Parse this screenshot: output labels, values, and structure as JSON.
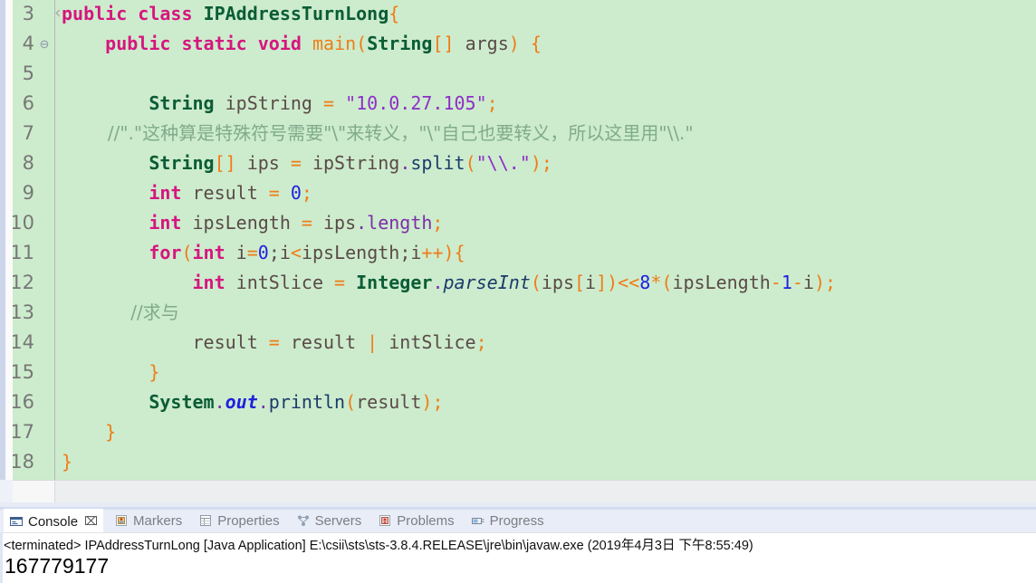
{
  "editor": {
    "first_line": 3,
    "fold_marker_line": 4,
    "fold_marker_glyph": "⊖",
    "collapse_chevron": "‹",
    "background": "#cdeccd",
    "lines": [
      {
        "n": 3,
        "indent": 0,
        "tokens": [
          {
            "t": "public",
            "c": "kw"
          },
          {
            "t": " ",
            "c": "plain"
          },
          {
            "t": "class",
            "c": "kw"
          },
          {
            "t": " ",
            "c": "plain"
          },
          {
            "t": "IPAddressTurnLong",
            "c": "type"
          },
          {
            "t": "{",
            "c": "op"
          }
        ]
      },
      {
        "n": 4,
        "indent": 0,
        "tokens": [
          {
            "t": "    ",
            "c": "plain"
          },
          {
            "t": "public",
            "c": "kw"
          },
          {
            "t": " ",
            "c": "plain"
          },
          {
            "t": "static",
            "c": "kw"
          },
          {
            "t": " ",
            "c": "plain"
          },
          {
            "t": "void",
            "c": "kw"
          },
          {
            "t": " ",
            "c": "plain"
          },
          {
            "t": "main",
            "c": "op"
          },
          {
            "t": "(",
            "c": "op"
          },
          {
            "t": "String",
            "c": "type"
          },
          {
            "t": "[]",
            "c": "op"
          },
          {
            "t": " args",
            "c": "plain"
          },
          {
            "t": ")",
            "c": "op"
          },
          {
            "t": " ",
            "c": "plain"
          },
          {
            "t": "{",
            "c": "op"
          }
        ]
      },
      {
        "n": 5,
        "indent": 0,
        "tokens": []
      },
      {
        "n": 6,
        "indent": 0,
        "tokens": [
          {
            "t": "        ",
            "c": "plain"
          },
          {
            "t": "String",
            "c": "type"
          },
          {
            "t": " ipString ",
            "c": "plain"
          },
          {
            "t": "=",
            "c": "op"
          },
          {
            "t": " ",
            "c": "plain"
          },
          {
            "t": "\"10.0.27.105\"",
            "c": "str"
          },
          {
            "t": ";",
            "c": "op"
          }
        ]
      },
      {
        "n": 7,
        "indent": 0,
        "cjk": true,
        "tokens": [
          {
            "t": "        ",
            "c": "plain"
          },
          {
            "t": "//\".\"这种算是特殊符号需要\"\\\"来转义，\"\\\"自己也要转义，所以这里用\"\\\\.\"",
            "c": "cmt"
          }
        ]
      },
      {
        "n": 8,
        "indent": 0,
        "tokens": [
          {
            "t": "        ",
            "c": "plain"
          },
          {
            "t": "String",
            "c": "type"
          },
          {
            "t": "[]",
            "c": "op"
          },
          {
            "t": " ips ",
            "c": "plain"
          },
          {
            "t": "=",
            "c": "op"
          },
          {
            "t": " ipString",
            "c": "plain"
          },
          {
            "t": ".",
            "c": "fld"
          },
          {
            "t": "split",
            "c": "meth"
          },
          {
            "t": "(",
            "c": "op"
          },
          {
            "t": "\"\\\\.\"",
            "c": "str"
          },
          {
            "t": ")",
            "c": "op"
          },
          {
            "t": ";",
            "c": "op"
          }
        ]
      },
      {
        "n": 9,
        "indent": 0,
        "tokens": [
          {
            "t": "        ",
            "c": "plain"
          },
          {
            "t": "int",
            "c": "kw"
          },
          {
            "t": " result ",
            "c": "plain"
          },
          {
            "t": "=",
            "c": "op"
          },
          {
            "t": " ",
            "c": "plain"
          },
          {
            "t": "0",
            "c": "num"
          },
          {
            "t": ";",
            "c": "op"
          }
        ]
      },
      {
        "n": 10,
        "indent": 0,
        "tokens": [
          {
            "t": "        ",
            "c": "plain"
          },
          {
            "t": "int",
            "c": "kw"
          },
          {
            "t": " ipsLength ",
            "c": "plain"
          },
          {
            "t": "=",
            "c": "op"
          },
          {
            "t": " ips",
            "c": "plain"
          },
          {
            "t": ".",
            "c": "fld"
          },
          {
            "t": "length",
            "c": "fld"
          },
          {
            "t": ";",
            "c": "op"
          }
        ]
      },
      {
        "n": 11,
        "indent": 0,
        "tokens": [
          {
            "t": "        ",
            "c": "plain"
          },
          {
            "t": "for",
            "c": "kw"
          },
          {
            "t": "(",
            "c": "op"
          },
          {
            "t": "int",
            "c": "kw"
          },
          {
            "t": " i",
            "c": "plain"
          },
          {
            "t": "=",
            "c": "op"
          },
          {
            "t": "0",
            "c": "num"
          },
          {
            "t": ";i",
            "c": "plain"
          },
          {
            "t": "<",
            "c": "op"
          },
          {
            "t": "ipsLength;i",
            "c": "plain"
          },
          {
            "t": "++",
            "c": "op"
          },
          {
            "t": ")",
            "c": "op"
          },
          {
            "t": "{",
            "c": "op"
          }
        ]
      },
      {
        "n": 12,
        "indent": 0,
        "tokens": [
          {
            "t": "            ",
            "c": "plain"
          },
          {
            "t": "int",
            "c": "kw"
          },
          {
            "t": " intSlice ",
            "c": "plain"
          },
          {
            "t": "=",
            "c": "op"
          },
          {
            "t": " ",
            "c": "plain"
          },
          {
            "t": "Integer",
            "c": "type"
          },
          {
            "t": ".",
            "c": "fld"
          },
          {
            "t": "parseInt",
            "c": "smeth"
          },
          {
            "t": "(",
            "c": "op"
          },
          {
            "t": "ips",
            "c": "plain"
          },
          {
            "t": "[",
            "c": "op"
          },
          {
            "t": "i",
            "c": "plain"
          },
          {
            "t": "]",
            "c": "op"
          },
          {
            "t": ")",
            "c": "op"
          },
          {
            "t": "<<",
            "c": "op"
          },
          {
            "t": "8",
            "c": "num"
          },
          {
            "t": "*",
            "c": "op"
          },
          {
            "t": "(",
            "c": "op"
          },
          {
            "t": "ipsLength",
            "c": "plain"
          },
          {
            "t": "-",
            "c": "op"
          },
          {
            "t": "1",
            "c": "num"
          },
          {
            "t": "-",
            "c": "op"
          },
          {
            "t": "i",
            "c": "plain"
          },
          {
            "t": ")",
            "c": "op"
          },
          {
            "t": ";",
            "c": "op"
          }
        ]
      },
      {
        "n": 13,
        "indent": 0,
        "cjk": true,
        "tokens": [
          {
            "t": "            ",
            "c": "plain"
          },
          {
            "t": "//求与",
            "c": "cmt"
          }
        ]
      },
      {
        "n": 14,
        "indent": 0,
        "tokens": [
          {
            "t": "            result ",
            "c": "plain"
          },
          {
            "t": "=",
            "c": "op"
          },
          {
            "t": " result ",
            "c": "plain"
          },
          {
            "t": "|",
            "c": "op"
          },
          {
            "t": " intSlice",
            "c": "plain"
          },
          {
            "t": ";",
            "c": "op"
          }
        ]
      },
      {
        "n": 15,
        "indent": 0,
        "tokens": [
          {
            "t": "        ",
            "c": "plain"
          },
          {
            "t": "}",
            "c": "op"
          }
        ]
      },
      {
        "n": 16,
        "indent": 0,
        "tokens": [
          {
            "t": "        ",
            "c": "plain"
          },
          {
            "t": "System",
            "c": "type"
          },
          {
            "t": ".",
            "c": "fld"
          },
          {
            "t": "out",
            "c": "sfld"
          },
          {
            "t": ".",
            "c": "fld"
          },
          {
            "t": "println",
            "c": "meth"
          },
          {
            "t": "(",
            "c": "op"
          },
          {
            "t": "result",
            "c": "plain"
          },
          {
            "t": ")",
            "c": "op"
          },
          {
            "t": ";",
            "c": "op"
          }
        ]
      },
      {
        "n": 17,
        "indent": 0,
        "tokens": [
          {
            "t": "    ",
            "c": "plain"
          },
          {
            "t": "}",
            "c": "op"
          }
        ]
      },
      {
        "n": 18,
        "indent": 0,
        "tokens": [
          {
            "t": "}",
            "c": "op"
          }
        ]
      }
    ]
  },
  "console": {
    "tabs": [
      {
        "label": "Console",
        "icon": "console-icon",
        "active": true,
        "closeable": true,
        "close_glyph": "⌧"
      },
      {
        "label": "Markers",
        "icon": "markers-icon",
        "active": false,
        "closeable": false
      },
      {
        "label": "Properties",
        "icon": "properties-icon",
        "active": false,
        "closeable": false
      },
      {
        "label": "Servers",
        "icon": "servers-icon",
        "active": false,
        "closeable": false
      },
      {
        "label": "Problems",
        "icon": "problems-icon",
        "active": false,
        "closeable": false
      },
      {
        "label": "Progress",
        "icon": "progress-icon",
        "active": false,
        "closeable": false
      }
    ],
    "terminated_line": "<terminated> IPAddressTurnLong [Java Application] E:\\csii\\sts\\sts-3.8.4.RELEASE\\jre\\bin\\javaw.exe (2019年4月3日 下午8:55:49)",
    "output": "167779177"
  }
}
